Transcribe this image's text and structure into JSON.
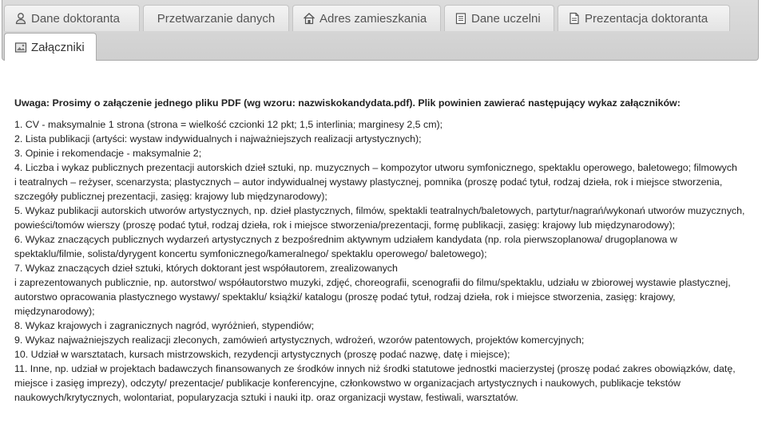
{
  "tabs": [
    {
      "label": "Dane doktoranta",
      "icon": "user-icon"
    },
    {
      "label": "Przetwarzanie danych",
      "icon": ""
    },
    {
      "label": "Adres zamieszkania",
      "icon": "home-icon"
    },
    {
      "label": "Dane uczelni",
      "icon": "document-icon"
    },
    {
      "label": "Prezentacja doktoranta",
      "icon": "page-icon"
    },
    {
      "label": "Załączniki",
      "icon": "attachment-icon",
      "active": true
    }
  ],
  "content": {
    "notice": "Uwaga: Prosimy o załączenie jednego pliku PDF (wg wzoru: nazwiskokandydata.pdf). Plik powinien zawierać następujący wykaz załączników:",
    "lines": [
      "1. CV - maksymalnie 1 strona (strona = wielkość czcionki 12 pkt; 1,5 interlinia; marginesy 2,5 cm);",
      "2. Lista publikacji (artyści: wystaw indywidualnych i najważniejszych realizacji artystycznych);",
      "3. Opinie i rekomendacje - maksymalnie 2;",
      "4. Liczba i wykaz publicznych prezentacji autorskich dzieł sztuki, np. muzycznych – kompozytor utworu symfonicznego, spektaklu operowego, baletowego; filmowych",
      "i teatralnych – reżyser, scenarzysta; plastycznych – autor indywidualnej wystawy plastycznej, pomnika (proszę podać tytuł, rodzaj dzieła, rok i miejsce stworzenia, szczegóły publicznej prezentacji, zasięg: krajowy lub międzynarodowy);",
      "5. Wykaz publikacji autorskich utworów artystycznych, np. dzieł plastycznych, filmów, spektakli teatralnych/baletowych, partytur/nagrań/wykonań utworów muzycznych, powieści/tomów wierszy (proszę podać tytuł, rodzaj dzieła, rok i miejsce stworzenia/prezentacji, formę publikacji, zasięg: krajowy lub międzynarodowy);",
      "6. Wykaz znaczących publicznych wydarzeń artystycznych z bezpośrednim aktywnym udziałem kandydata (np. rola pierwszoplanowa/ drugoplanowa w spektaklu/filmie, solista/dyrygent koncertu symfonicznego/kameralnego/ spektaklu operowego/ baletowego);",
      "7. Wykaz znaczących dzieł sztuki, których doktorant jest współautorem, zrealizowanych",
      "i zaprezentowanych publicznie, np. autorstwo/ współautorstwo muzyki, zdjęć, choreografii, scenografii do filmu/spektaklu, udziału w zbiorowej wystawie plastycznej, autorstwo opracowania plastycznego wystawy/ spektaklu/ książki/ katalogu (proszę podać tytuł, rodzaj dzieła, rok i miejsce stworzenia, zasięg: krajowy, międzynarodowy);",
      "8. Wykaz krajowych i zagranicznych nagród, wyróżnień, stypendiów;",
      "9. Wykaz najważniejszych realizacji zleconych, zamówień artystycznych, wdrożeń, wzorów patentowych, projektów komercyjnych;",
      "10. Udział w warsztatach, kursach mistrzowskich, rezydencji artystycznych (proszę podać nazwę, datę i miejsce);",
      "11. Inne, np. udział w projektach badawczych finansowanych ze środków innych niż środki statutowe jednostki macierzystej (proszę podać zakres obowiązków, datę, miejsce i zasięg imprezy), odczyty/ prezentacje/ publikacje konferencyjne, członkowstwo w organizacjach artystycznych i naukowych, publikacje tekstów naukowych/krytycznych, wolontariat, popularyzacja sztuki i nauki itp. oraz organizacji wystaw, festiwali, warsztatów."
    ]
  }
}
